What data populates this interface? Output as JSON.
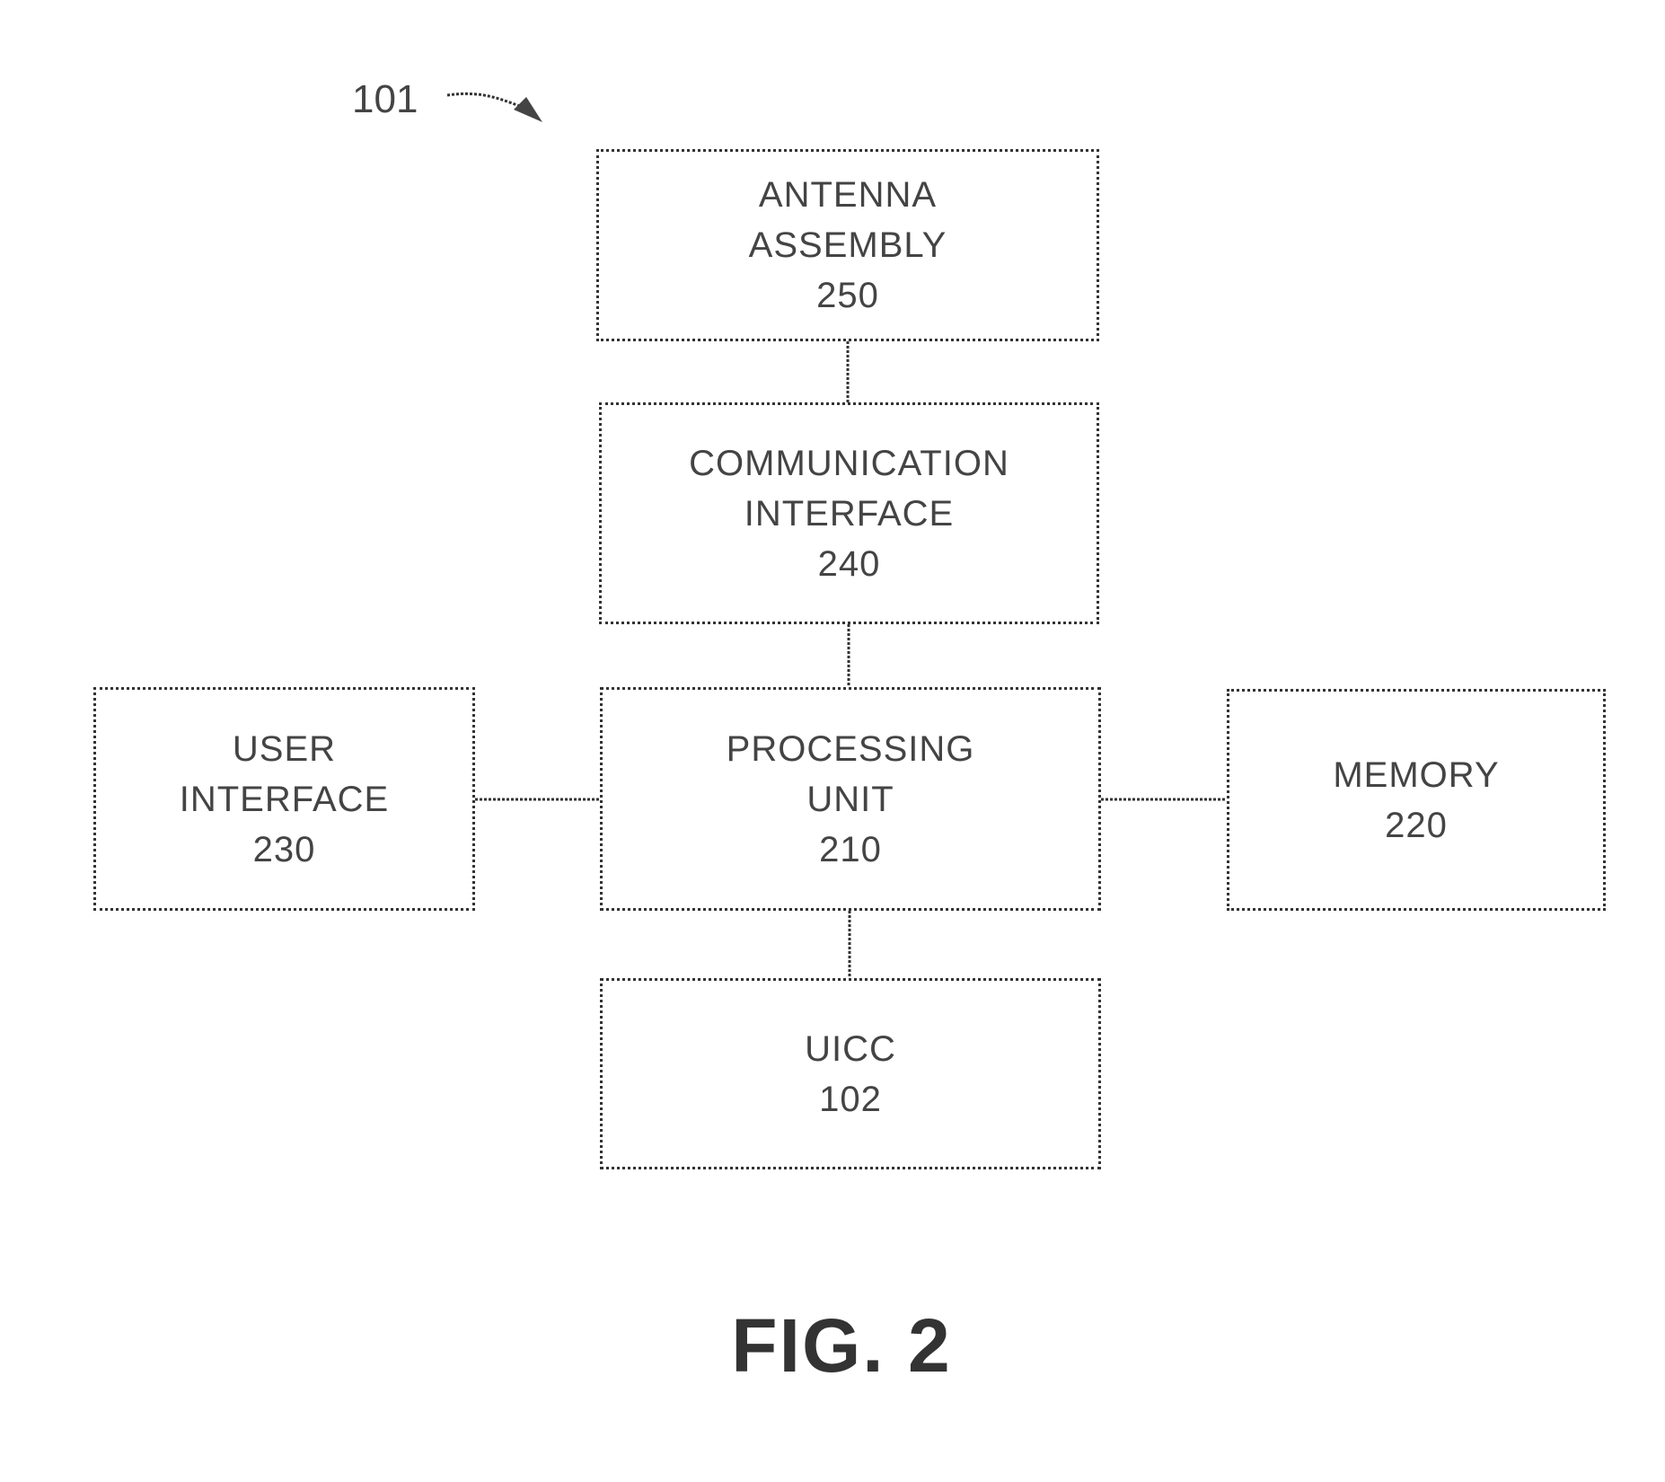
{
  "figure": {
    "reference_label": "101",
    "caption": "FIG. 2"
  },
  "blocks": {
    "antenna": {
      "lines": [
        "ANTENNA",
        "ASSEMBLY",
        "250"
      ]
    },
    "communication": {
      "lines": [
        "COMMUNICATION",
        "INTERFACE",
        "240"
      ]
    },
    "processing": {
      "lines": [
        "PROCESSING",
        "UNIT",
        "210"
      ]
    },
    "user_interface": {
      "lines": [
        "USER",
        "INTERFACE",
        "230"
      ]
    },
    "memory": {
      "lines": [
        "MEMORY",
        "220"
      ]
    },
    "uicc": {
      "lines": [
        "UICC",
        "102"
      ]
    }
  },
  "connections": [
    [
      "antenna",
      "communication"
    ],
    [
      "communication",
      "processing"
    ],
    [
      "user_interface",
      "processing"
    ],
    [
      "processing",
      "memory"
    ],
    [
      "processing",
      "uicc"
    ]
  ]
}
